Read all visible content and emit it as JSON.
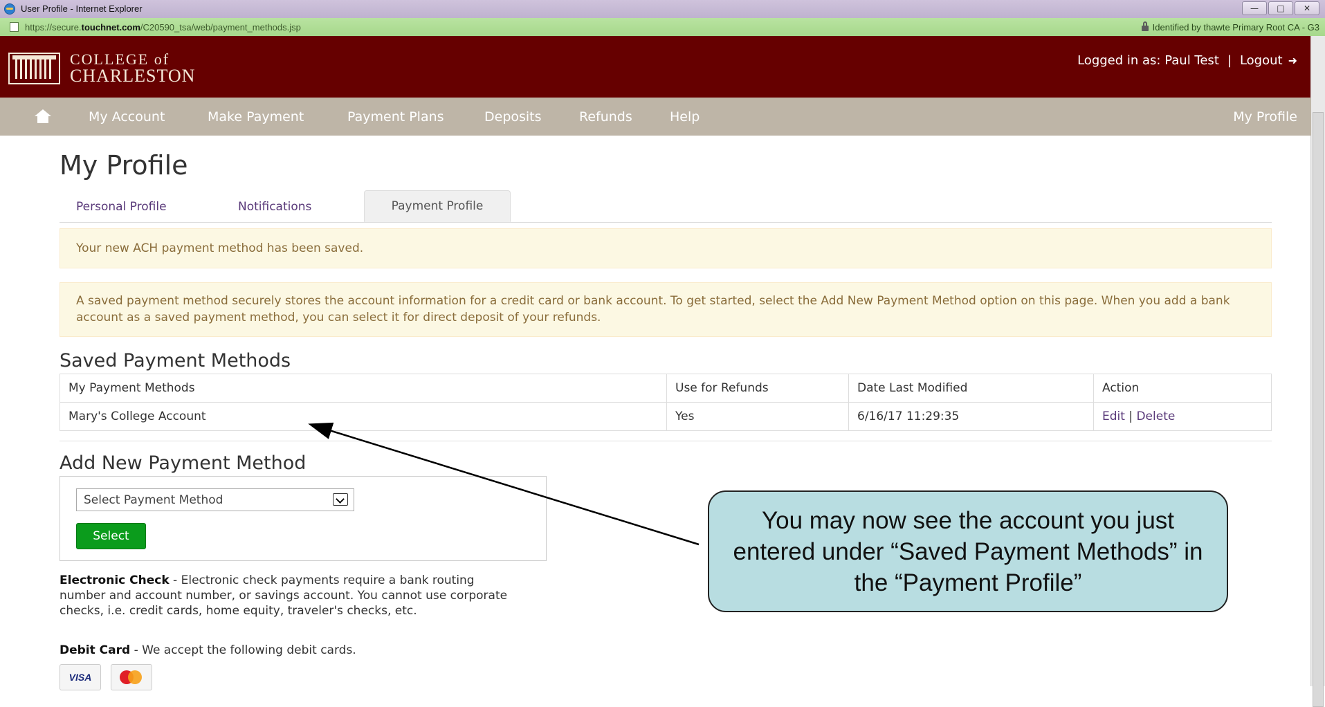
{
  "browser": {
    "window_title": "User Profile - Internet Explorer",
    "url_prefix": "https://secure.",
    "url_domain": "touchnet.com",
    "url_path": "/C20590_tsa/web/payment_methods.jsp",
    "certificate": "Identified by thawte Primary Root CA - G3",
    "window_buttons": [
      "—",
      "□",
      "✕"
    ]
  },
  "header": {
    "logo_line1": "COLLEGE of",
    "logo_line2": "CHARLESTON",
    "logged_in": "Logged in as: Paul Test",
    "separator": "|",
    "logout": "Logout",
    "color": "#660000"
  },
  "nav": {
    "items": [
      "My Account",
      "Make Payment",
      "Payment Plans",
      "Deposits",
      "Refunds",
      "Help"
    ],
    "profile": "My Profile",
    "color": "#beb5a7"
  },
  "main": {
    "title": "My Profile",
    "tabs": [
      "Personal Profile",
      "Notifications",
      "Payment Profile"
    ],
    "active_tab": "Payment Profile",
    "alert_saved": "Your new ACH payment method has been saved.",
    "alert_info": "A saved payment method securely stores the account information for a credit card or bank account. To get started, select the Add New Payment Method option on this page. When you add a bank account as a saved payment method, you can select it for direct deposit of your refunds.",
    "saved_title": "Saved Payment Methods",
    "table": {
      "headers": [
        "My Payment Methods",
        "Use for Refunds",
        "Date Last Modified",
        "Action"
      ],
      "rows": [
        {
          "name": "Mary's College Account",
          "refunds": "Yes",
          "modified": "6/16/17 11:29:35",
          "edit": "Edit",
          "sep": "|",
          "delete": "Delete"
        }
      ]
    },
    "add_title": "Add New Payment Method",
    "select_value": "Select Payment Method",
    "select_button": "Select",
    "echeck_label": "Electronic Check",
    "echeck_text": " - Electronic check payments require a bank routing number and account number, or savings account. You cannot use corporate checks, i.e. credit cards, home equity, traveler's checks, etc.",
    "debit_label": "Debit Card",
    "debit_text": " - We accept the following debit cards.",
    "cards": [
      "VISA",
      "MasterCard"
    ]
  },
  "callout": {
    "text": "You may now see the account you just entered under “Saved Payment Methods” in the “Payment Profile”",
    "color": "#b8dde1"
  }
}
